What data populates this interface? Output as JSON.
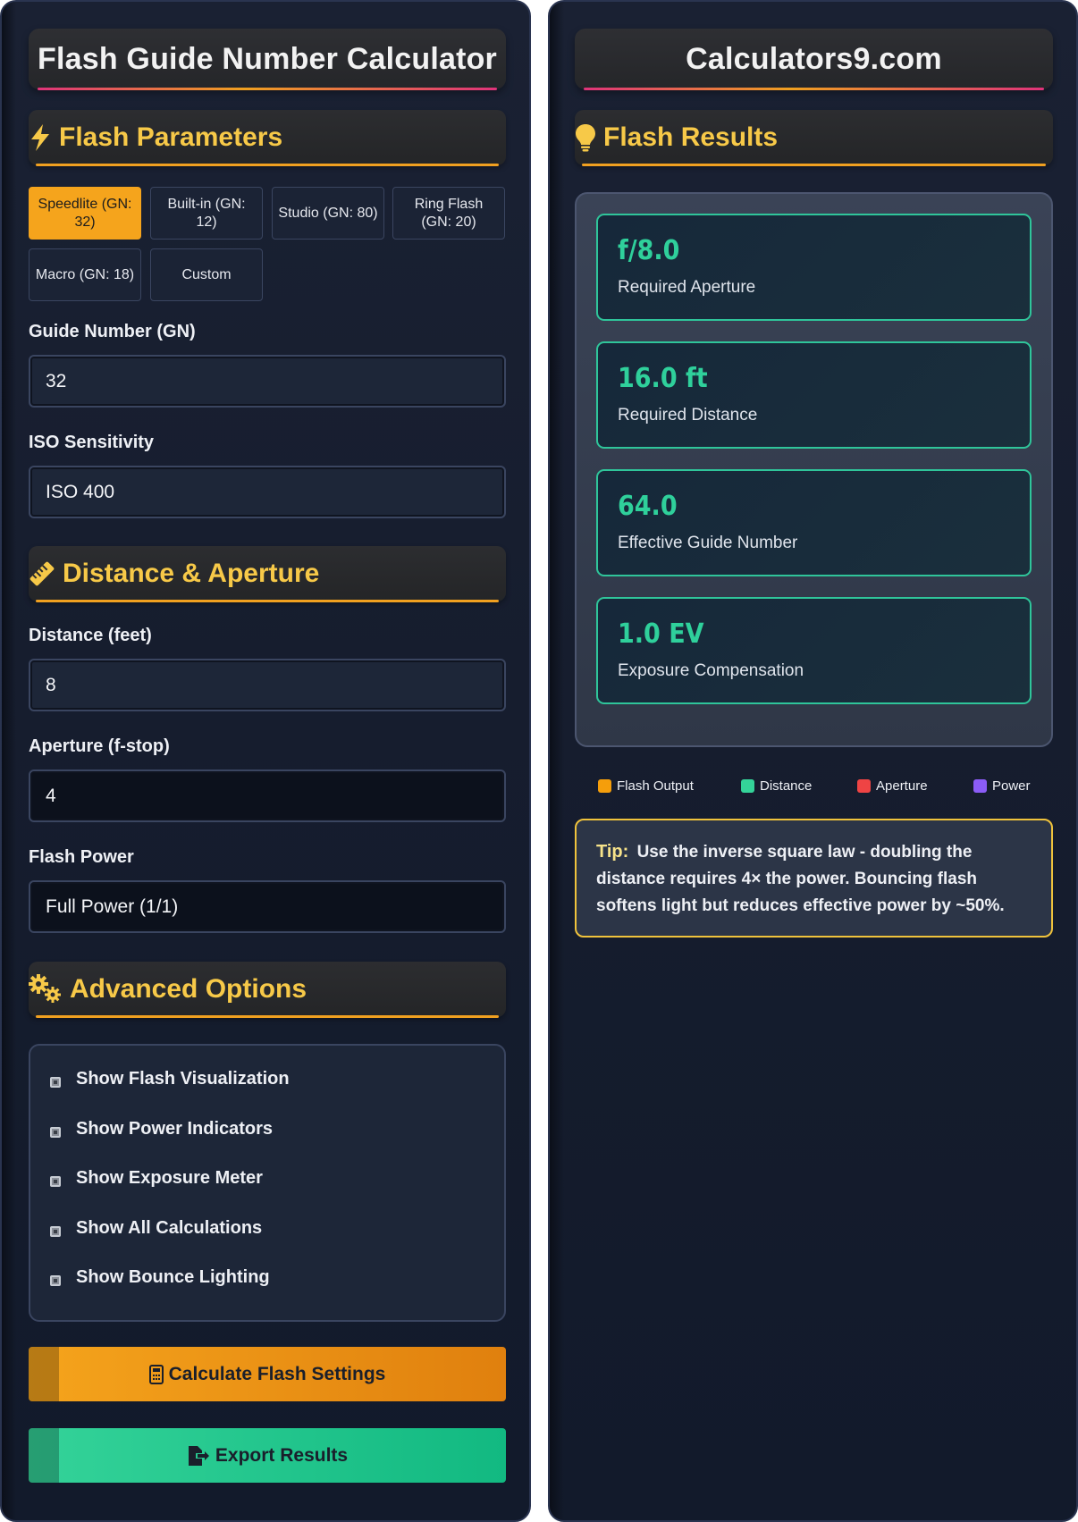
{
  "left": {
    "title": "Flash Guide Number Calculator",
    "sections": {
      "flash_parameters": "Flash Parameters",
      "distance_aperture": "Distance & Aperture",
      "advanced_options": "Advanced Options"
    },
    "presets": [
      {
        "label": "Speedlite (GN: 32)",
        "active": true
      },
      {
        "label": "Built-in (GN: 12)",
        "active": false
      },
      {
        "label": "Studio (GN: 80)",
        "active": false
      },
      {
        "label": "Ring Flash (GN: 20)",
        "active": false
      },
      {
        "label": "Macro (GN: 18)",
        "active": false
      },
      {
        "label": "Custom",
        "active": false
      }
    ],
    "fields": {
      "guide_number": {
        "label": "Guide Number (GN)",
        "value": "32"
      },
      "iso": {
        "label": "ISO Sensitivity",
        "value": "ISO 400"
      },
      "distance": {
        "label": "Distance (feet)",
        "value": "8"
      },
      "aperture": {
        "label": "Aperture (f-stop)",
        "value": "4"
      },
      "flash_power": {
        "label": "Flash Power",
        "value": "Full Power (1/1)"
      }
    },
    "options": [
      "Show Flash Visualization",
      "Show Power Indicators",
      "Show Exposure Meter",
      "Show All Calculations",
      "Show Bounce Lighting"
    ],
    "buttons": {
      "calculate": "Calculate Flash Settings",
      "export": "Export Results"
    }
  },
  "right": {
    "title": "Calculators9.com",
    "section": "Flash Results",
    "results": [
      {
        "value": "f/8.0",
        "label": "Required Aperture"
      },
      {
        "value": "16.0 ft",
        "label": "Required Distance"
      },
      {
        "value": "64.0",
        "label": "Effective Guide Number"
      },
      {
        "value": "1.0 EV",
        "label": "Exposure Compensation"
      }
    ],
    "legend": [
      {
        "label": "Flash Output",
        "color": "#f59e0b"
      },
      {
        "label": "Distance",
        "color": "#34d399"
      },
      {
        "label": "Aperture",
        "color": "#ef4444"
      },
      {
        "label": "Power",
        "color": "#8b5cf6"
      }
    ],
    "tip": {
      "label": "Tip:",
      "text": "Use the inverse square law - doubling the distance requires 4× the power. Bouncing flash softens light but reduces effective power by ~50%."
    }
  },
  "colors": {
    "accent_orange": "#f5a41c",
    "accent_green": "#2fd09b",
    "accent_yellow": "#f7c948"
  }
}
